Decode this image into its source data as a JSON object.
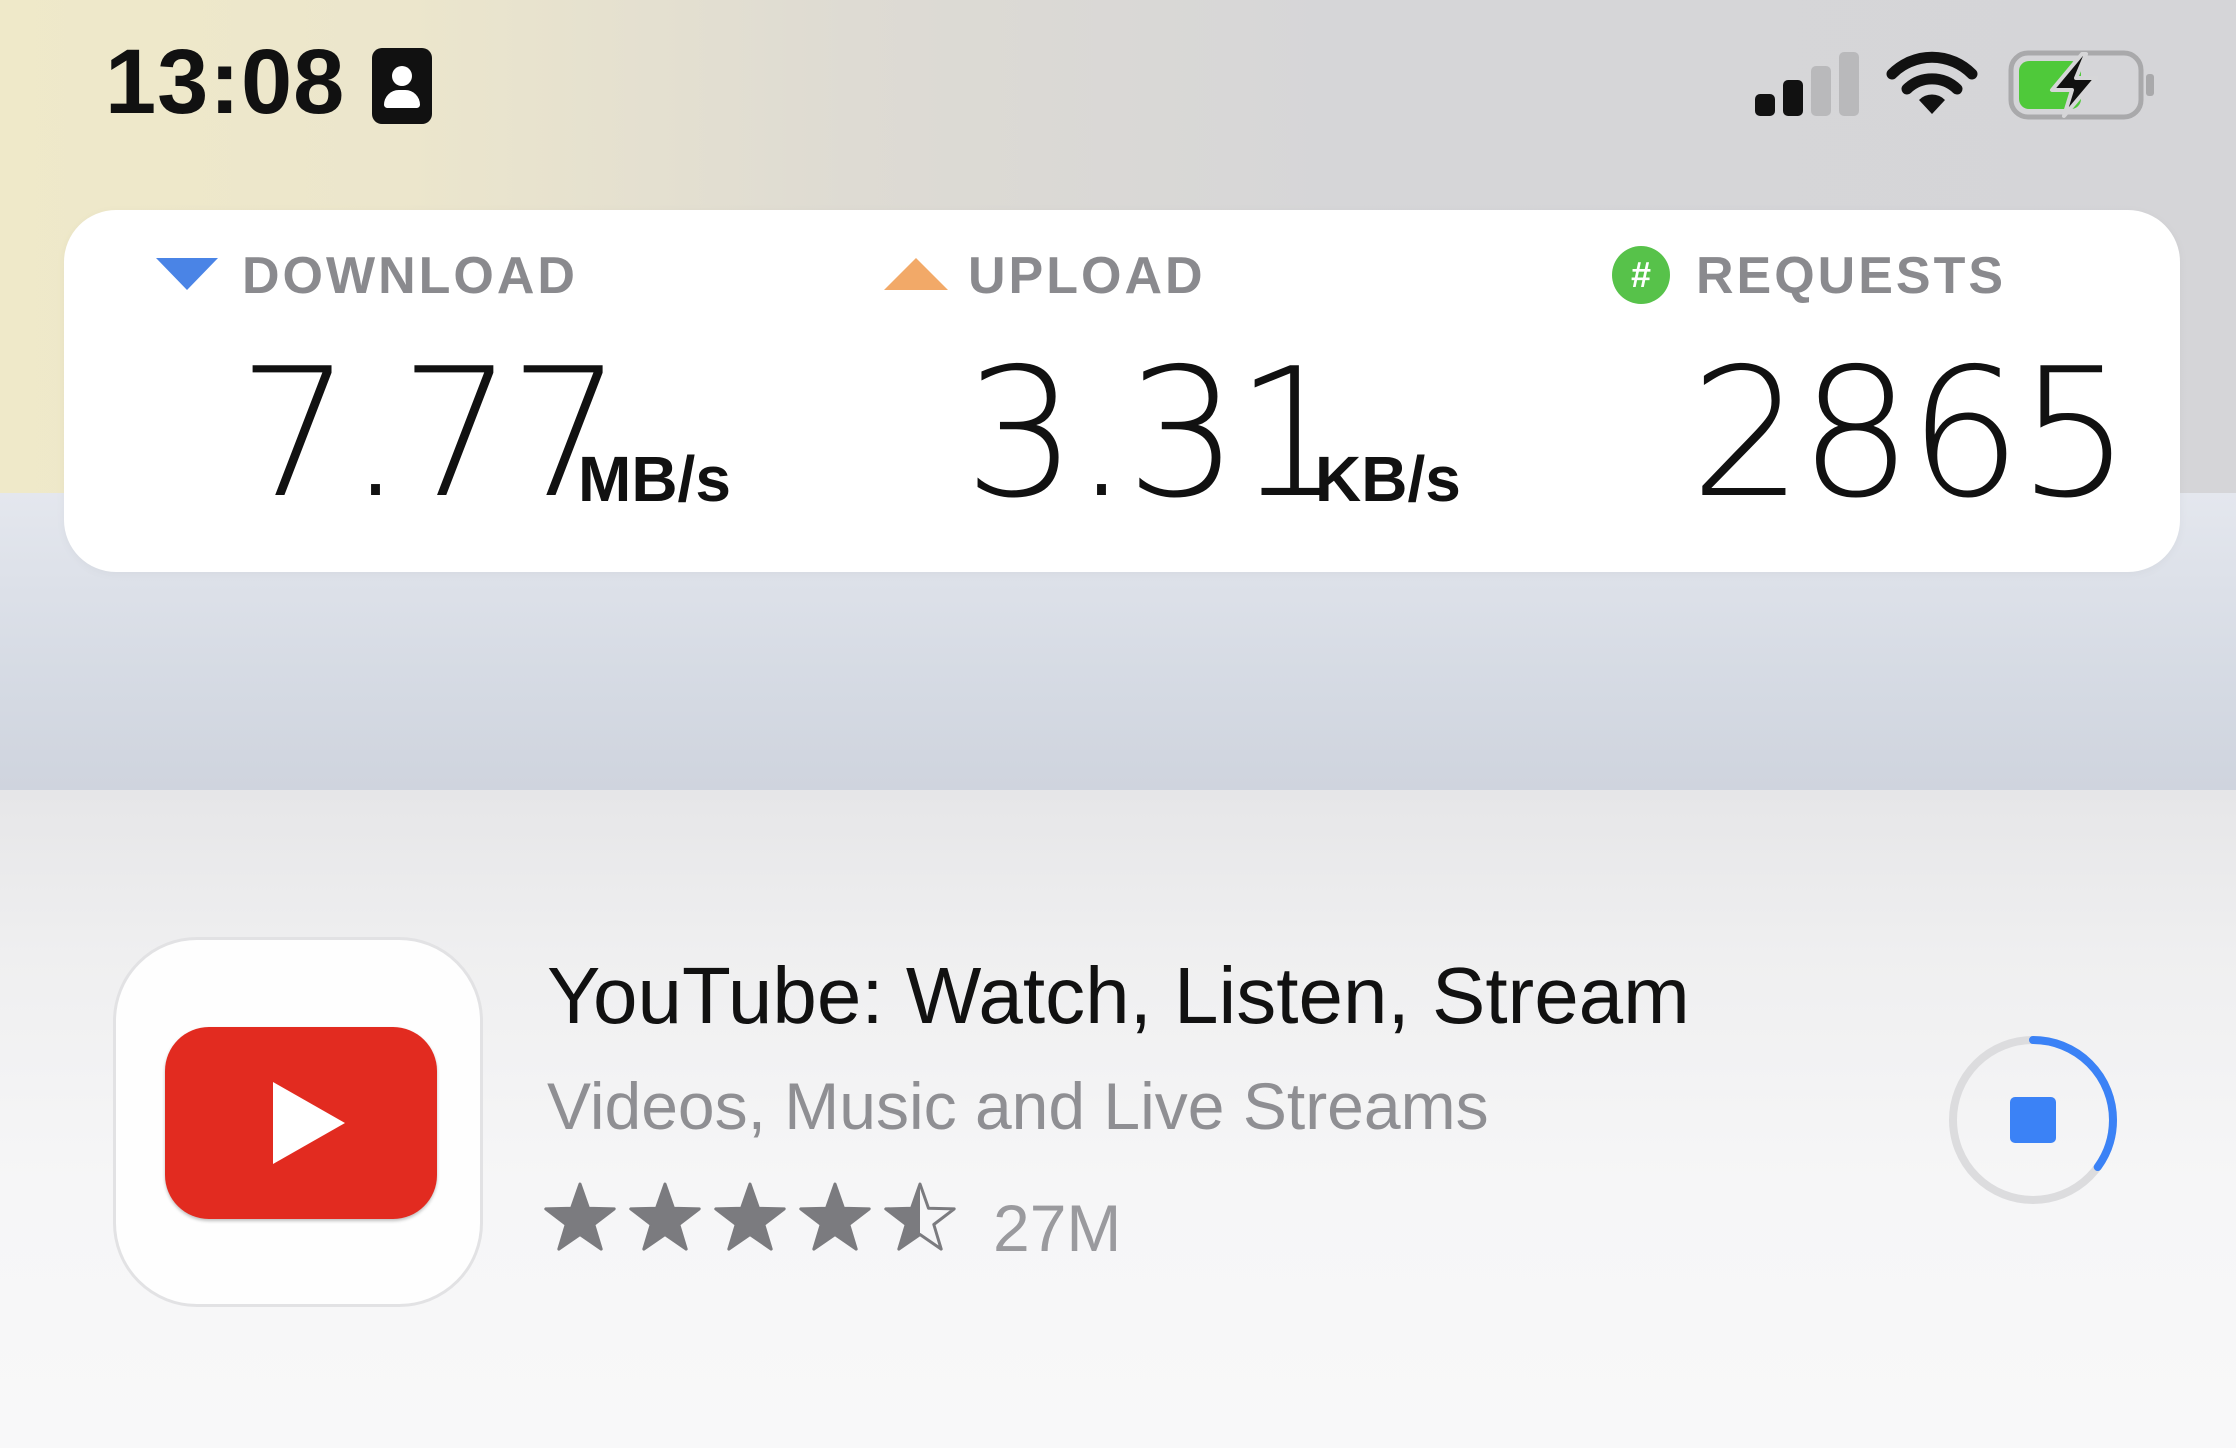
{
  "status_bar": {
    "time": "13:08",
    "icons": [
      "contact-card-icon",
      "cellular-signal-icon",
      "wifi-icon",
      "battery-charging-icon"
    ],
    "battery_color": "#4fc93a"
  },
  "network_stats": {
    "download": {
      "label": "DOWNLOAD",
      "value": "7.77",
      "unit": "MB/s",
      "icon": "triangle-down-icon",
      "color": "#4a84e6"
    },
    "upload": {
      "label": "UPLOAD",
      "value": "3.31",
      "unit": "KB/s",
      "icon": "triangle-up-icon",
      "color": "#f2a968"
    },
    "requests": {
      "label": "REQUESTS",
      "value": "2865",
      "icon": "hash-icon",
      "icon_text": "#",
      "color": "#57c24a"
    }
  },
  "app": {
    "name": "YouTube: Watch, Listen, Stream",
    "subtitle": "Videos, Music and Live Streams",
    "rating_stars": 4.5,
    "rating_count": "27M",
    "icon": "youtube-logo-icon",
    "brand_color": "#e22b20",
    "download_progress": 0.35,
    "progress_color": "#3b82f6"
  }
}
